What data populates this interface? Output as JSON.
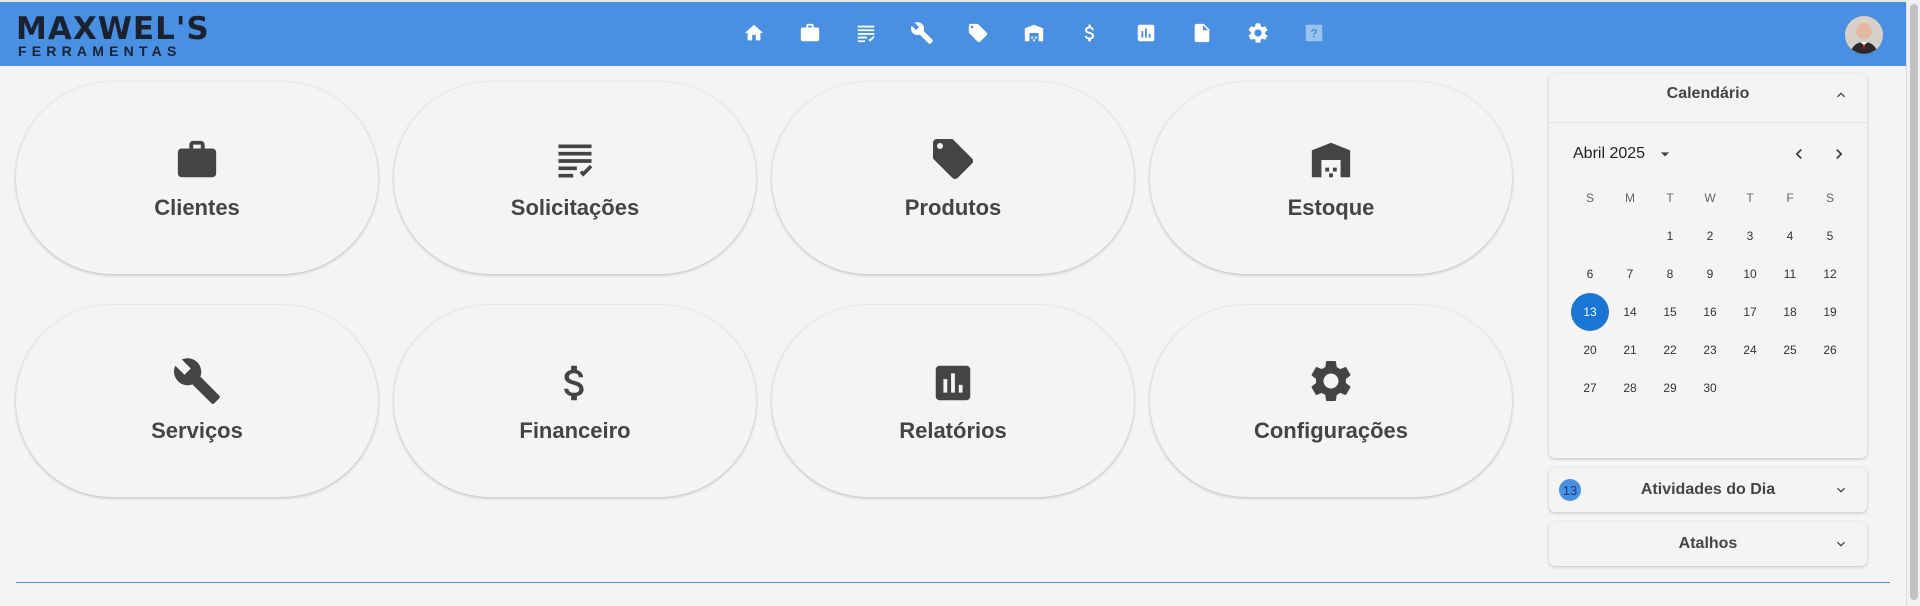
{
  "header": {
    "logo_line1": "MAXWEL'S",
    "logo_line2": "FERRAMENTAS",
    "nav_icons": [
      "home-icon",
      "briefcase-icon",
      "receipt-list-icon",
      "wrench-icon",
      "tag-icon",
      "warehouse-icon",
      "dollar-icon",
      "bar-chart-icon",
      "document-icon",
      "gear-icon",
      "help-icon"
    ]
  },
  "cards": [
    {
      "label": "Clientes",
      "icon": "briefcase-icon"
    },
    {
      "label": "Solicitações",
      "icon": "receipt-list-icon"
    },
    {
      "label": "Produtos",
      "icon": "tag-icon"
    },
    {
      "label": "Estoque",
      "icon": "warehouse-icon"
    },
    {
      "label": "Serviços",
      "icon": "wrench-icon"
    },
    {
      "label": "Financeiro",
      "icon": "dollar-icon"
    },
    {
      "label": "Relatórios",
      "icon": "bar-chart-icon"
    },
    {
      "label": "Configurações",
      "icon": "gear-icon"
    }
  ],
  "calendar": {
    "title": "Calendário",
    "month_label": "Abril 2025",
    "weekdays": [
      "S",
      "M",
      "T",
      "W",
      "T",
      "F",
      "S"
    ],
    "days": [
      "",
      "",
      "1",
      "2",
      "3",
      "4",
      "5",
      "6",
      "7",
      "8",
      "9",
      "10",
      "11",
      "12",
      "13",
      "14",
      "15",
      "16",
      "17",
      "18",
      "19",
      "20",
      "21",
      "22",
      "23",
      "24",
      "25",
      "26",
      "27",
      "28",
      "29",
      "30"
    ],
    "selected_day": "13"
  },
  "activities": {
    "title": "Atividades do Dia",
    "badge": "13"
  },
  "shortcuts": {
    "title": "Atalhos"
  },
  "colors": {
    "header": "#4a90e2",
    "selected": "#1976d2",
    "icon": "#444444"
  }
}
